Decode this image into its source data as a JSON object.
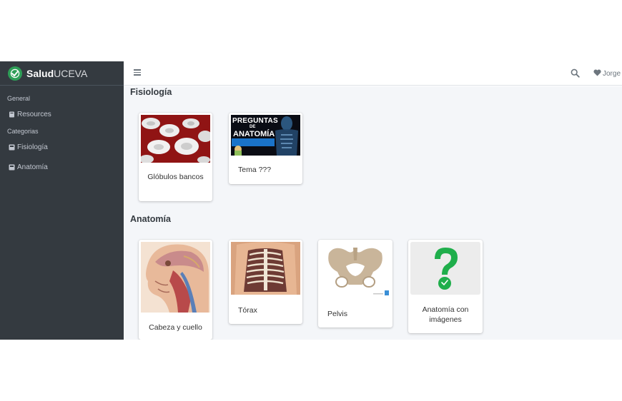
{
  "brand": {
    "name_bold": "Salud",
    "name_rest": "UCEVA"
  },
  "sidebar": {
    "header_general": "General",
    "resources": "Resources",
    "header_categorias": "Categorias",
    "fisiologia": "Fisiología",
    "anatomia": "Anatomía"
  },
  "topbar": {
    "user_name": "Jorge"
  },
  "sections": {
    "fisiologia": {
      "title": "Fisiología",
      "cards": [
        {
          "label": "Glóbulos bancos"
        },
        {
          "label": "Tema ???",
          "thumb_text_1": "PREGUNTAS",
          "thumb_text_2": "DE",
          "thumb_text_3": "ANATOMÍA"
        }
      ]
    },
    "anatomia": {
      "title": "Anatomía",
      "cards": [
        {
          "label": "Cabeza y cuello"
        },
        {
          "label": "Tórax"
        },
        {
          "label": "Pelvis"
        },
        {
          "label": "Anatomía con imágenes"
        }
      ]
    }
  },
  "colors": {
    "sidebar_bg": "#343a40",
    "content_bg": "#f4f6f9",
    "brand_green": "#2e9e57",
    "qmark_green": "#1fae4b"
  }
}
